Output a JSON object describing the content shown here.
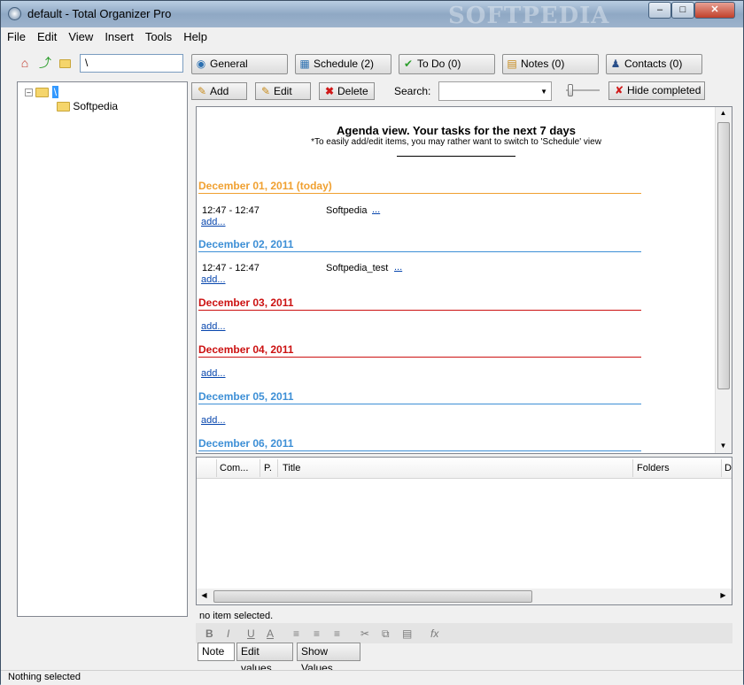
{
  "window": {
    "title": "default - Total Organizer Pro",
    "watermark": "SOFTPEDIA",
    "controls": [
      "minimize",
      "maximize",
      "close"
    ]
  },
  "menu": [
    "File",
    "Edit",
    "View",
    "Insert",
    "Tools",
    "Help"
  ],
  "toolbar": {
    "icons": [
      "home-icon",
      "back-arrow-icon",
      "new-folder-icon"
    ],
    "path_value": "\\",
    "categories": [
      {
        "label": "General",
        "icon": "globe-icon"
      },
      {
        "label": "Schedule (2)",
        "icon": "calendar-icon"
      },
      {
        "label": "To Do (0)",
        "icon": "checkmark-icon"
      },
      {
        "label": "Notes (0)",
        "icon": "note-icon"
      },
      {
        "label": "Contacts (0)",
        "icon": "person-icon"
      }
    ]
  },
  "tree": {
    "root": "\\",
    "children": [
      "Softpedia"
    ]
  },
  "actions": {
    "add": "Add",
    "edit": "Edit",
    "delete": "Delete",
    "search_label": "Search:",
    "search_value": "",
    "hide_completed": "Hide completed"
  },
  "agenda": {
    "title": "Agenda view. Your tasks for the next 7 days",
    "subtitle": "*To easily add/edit items, you may rather want to switch to 'Schedule' view",
    "add_label": "add...",
    "days": [
      {
        "label": "December 01, 2011 (today)",
        "color": "#f0a030",
        "entries": [
          {
            "time": "12:47 - 12:47",
            "title": "Softpedia",
            "more": "..."
          }
        ]
      },
      {
        "label": "December 02, 2011",
        "color": "#3d8fd6",
        "entries": [
          {
            "time": "12:47 - 12:47",
            "title": "Softpedia_test",
            "more": "..."
          }
        ]
      },
      {
        "label": "December 03, 2011",
        "color": "#cc1111",
        "entries": []
      },
      {
        "label": "December 04, 2011",
        "color": "#cc1111",
        "entries": []
      },
      {
        "label": "December 05, 2011",
        "color": "#3d8fd6",
        "entries": []
      },
      {
        "label": "December 06, 2011",
        "color": "#3d8fd6",
        "entries": []
      }
    ]
  },
  "grid": {
    "columns": [
      "Com...",
      "P.",
      "Title",
      "Folders",
      "D"
    ]
  },
  "notes": {
    "status": "no item selected.",
    "tabs": [
      "Note",
      "Edit values",
      "Show Values"
    ],
    "format_icons": [
      "B",
      "I",
      "U",
      "A",
      "align-left",
      "align-center",
      "align-right",
      "cut",
      "copy",
      "paste",
      "fx"
    ]
  },
  "statusbar": "Nothing selected"
}
